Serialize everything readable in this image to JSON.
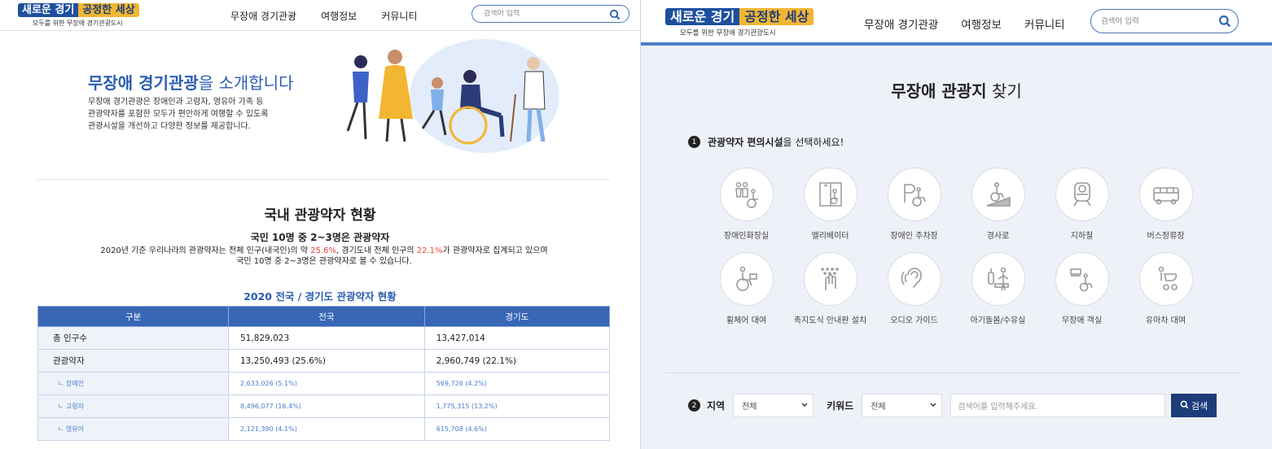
{
  "left": {
    "logo": {
      "part1": "새로운 경기",
      "part2": "공정한 세상",
      "tagline": "모두를 위한 무장애 경기관광도시"
    },
    "nav": [
      "무장애 경기관광",
      "여행정보",
      "커뮤니티"
    ],
    "search_placeholder": "검색어 입력",
    "intro": {
      "title_bold": "무장애 경기관광",
      "title_rest": "을 소개합니다",
      "desc": [
        "무장애 경기관광은 장애인과 고령자, 영유아 가족 등",
        "관광약자를 포함한 모두가 편안하게 여행할 수 있도록",
        "관광시설을 개선하고 다양한 정보를 제공합니다."
      ]
    },
    "stats": {
      "title": "국내 관광약자 현황",
      "subtitle": "국민 10명 중 2~3명은 관광약자",
      "desc_a": "2020년 기준 우리나라의 관광약자는 전체 인구(내국인)의 약 ",
      "desc_hl1": "25.6%",
      "desc_b": ", 경기도내 전체 인구의 ",
      "desc_hl2": "22.1%",
      "desc_c": "가 관광약자로 집계되고 있으며",
      "desc_d": "국민 10명 중 2~3명은 관광약자로 볼 수 있습니다.",
      "table_title": "2020 전국 / 경기도 관광약자 현황",
      "headers": [
        "구분",
        "전국",
        "경기도"
      ],
      "rows": [
        [
          "총 인구수",
          "51,829,023",
          "13,427,014"
        ],
        [
          "관광약자",
          "13,250,493 (25.6%)",
          "2,960,749 (22.1%)"
        ],
        [
          "ㄴ 장애인",
          "2,633,026 (5.1%)",
          "569,726 (4.2%)"
        ],
        [
          "ㄴ 고령자",
          "8,496,077 (16.4%)",
          "1,775,315 (13.2%)"
        ],
        [
          "ㄴ 영유아",
          "2,121,390 (4.1%)",
          "615,708 (4.6%)"
        ]
      ]
    }
  },
  "right": {
    "logo": {
      "part1": "새로운 경기",
      "part2": "공정한 세상",
      "tagline": "모두를 위한 무장애 경기관광도시"
    },
    "nav": [
      "무장애 경기관광",
      "여행정보",
      "커뮤니티"
    ],
    "search_placeholder": "검색어 입력",
    "title_bold": "무장애 관광지",
    "title_rest": " 찾기",
    "step1_num": "1",
    "step1_bold": "관광약자 편의시설",
    "step1_rest": "을 선택하세요!",
    "facilities": [
      {
        "label": "장애인화장실",
        "icon": "accessible-toilet-icon"
      },
      {
        "label": "엘리베이터",
        "icon": "elevator-icon"
      },
      {
        "label": "장애인 주차장",
        "icon": "accessible-parking-icon"
      },
      {
        "label": "경사로",
        "icon": "ramp-icon"
      },
      {
        "label": "지하철",
        "icon": "subway-icon"
      },
      {
        "label": "버스정류장",
        "icon": "bus-icon"
      },
      {
        "label": "휠체어 대여",
        "icon": "wheelchair-rental-icon"
      },
      {
        "label": "촉지도식 안내판 설치",
        "icon": "tactile-map-icon"
      },
      {
        "label": "오디오 가이드",
        "icon": "audio-guide-icon"
      },
      {
        "label": "아기돌봄/수유실",
        "icon": "nursing-room-icon"
      },
      {
        "label": "무장애 객실",
        "icon": "accessible-room-icon"
      },
      {
        "label": "유아차 대여",
        "icon": "stroller-rental-icon"
      }
    ],
    "step2_num": "2",
    "region_label": "지역",
    "region_value": "전체",
    "keyword_label": "키워드",
    "keyword_value": "전체",
    "search_input_placeholder": "검색어를 입력해주세요.",
    "search_button": "검색",
    "colors": {
      "primary": "#2a5db0",
      "accent_red": "#e8453c",
      "button": "#1d3c7a",
      "header_bar": "#4a80c8"
    }
  }
}
